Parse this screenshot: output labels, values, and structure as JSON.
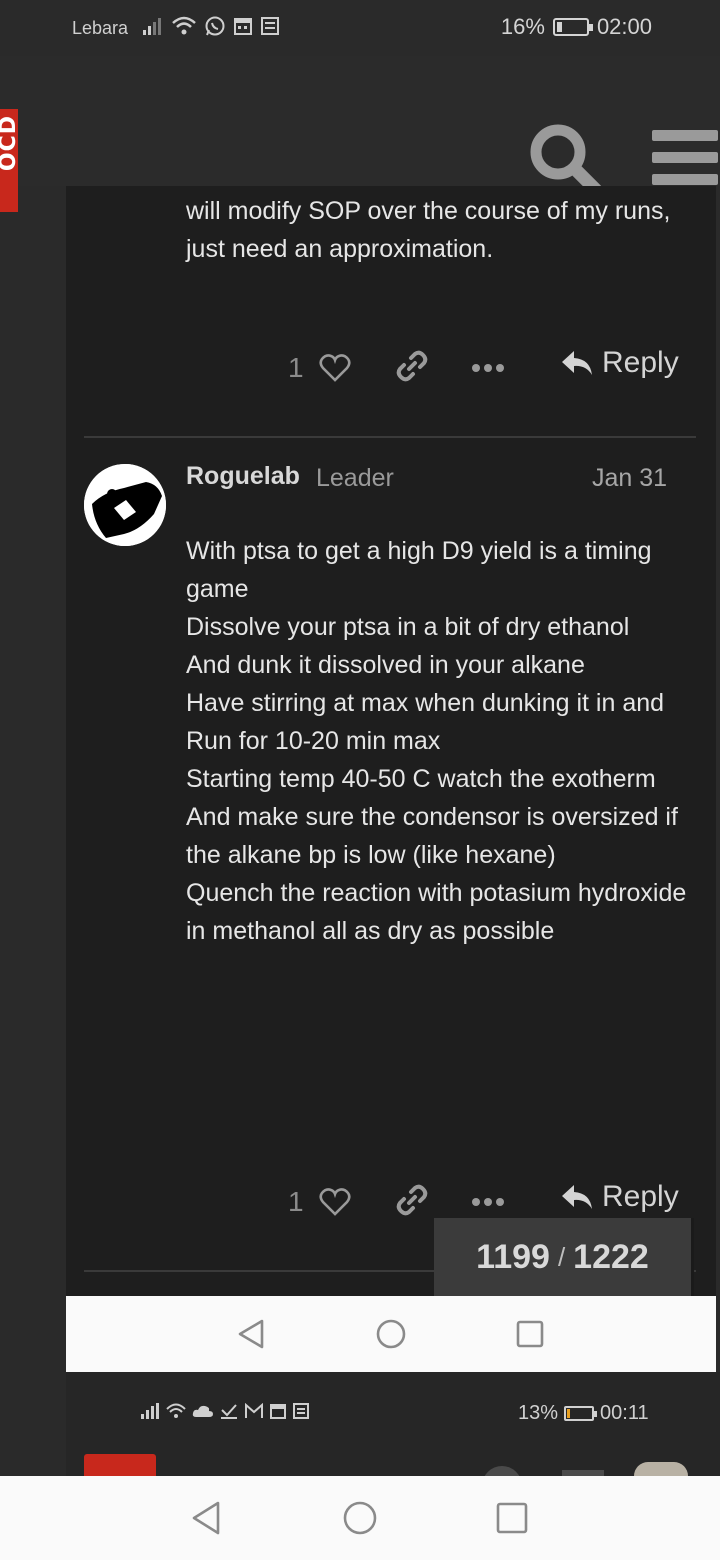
{
  "status_bar": {
    "carrier": "Lebara",
    "battery": "16%",
    "battery_level": 0.16,
    "time": "02:00"
  },
  "header": {
    "logo_text": "OCD"
  },
  "post_previous": {
    "text": "will modify SOP over the course of my runs, just need an approximation.",
    "like_count": "1",
    "reply_label": "Reply"
  },
  "post_current": {
    "username": "Roguelab",
    "role": "Leader",
    "date": "Jan 31",
    "lines": [
      "With ptsa to get a high D9 yield is a timing game",
      "Dissolve your ptsa in a bit of dry ethanol",
      "And dunk it dissolved in your alkane",
      "Have stirring at max when dunking it in and",
      "Run for 10-20 min max",
      "Starting temp 40-50 C watch the exotherm",
      "And make sure the condensor is oversized if the alkane bp is low (like hexane)",
      "Quench the reaction with potasium hydroxide in methanol all as dry as possible"
    ],
    "like_count": "1",
    "reply_label": "Reply"
  },
  "topic_progress": {
    "current": "1199",
    "separator": "/",
    "total": "1222"
  },
  "status_bar_2": {
    "battery": "13%",
    "battery_level": 0.13,
    "time": "00:11"
  }
}
